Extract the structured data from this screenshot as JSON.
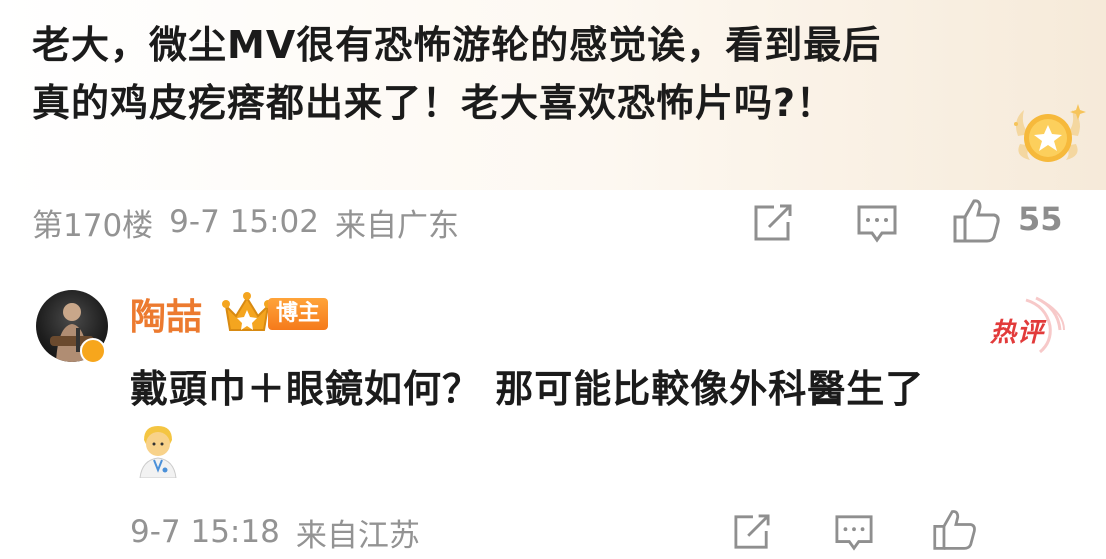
{
  "comment": {
    "text_line1": "老大，微尘MV很有恐怖游轮的感觉诶，看到最后",
    "text_line2": "真的鸡皮疙瘩都出来了！老大喜欢恐怖片吗?！",
    "floor": "第170楼",
    "time": "9-7 15:02",
    "location": "来自广东",
    "like_count": "55",
    "icons": [
      "medal-icon",
      "share-icon",
      "comment-icon",
      "like-icon"
    ]
  },
  "reply": {
    "user_name": "陶喆",
    "role_tag": "博主",
    "hot_label": "热评",
    "text": "戴頭巾＋眼鏡如何？ 那可能比較像外科醫生了",
    "time": "9-7 15:18",
    "location": "来自江苏",
    "icons": [
      "avatar",
      "verified-badge-icon",
      "crown-icon",
      "share-icon",
      "comment-icon",
      "like-icon",
      "doctor-emoji-icon"
    ]
  },
  "colors": {
    "username": "#ec7a2f",
    "hot": "#e23b3b",
    "meta": "#939393",
    "tag": "#f57a1b"
  }
}
